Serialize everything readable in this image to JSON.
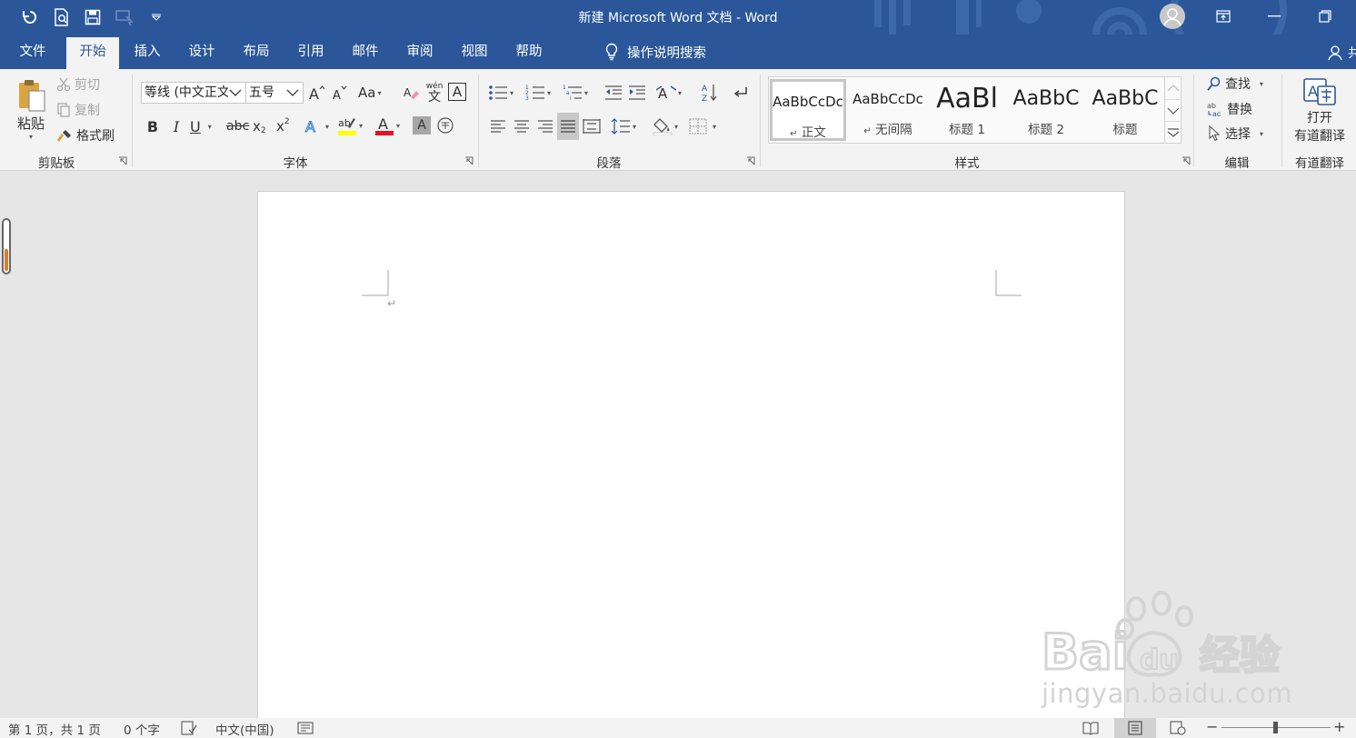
{
  "window": {
    "title": "新建 Microsoft Word 文档  -  Word",
    "accent": "#2b579a"
  },
  "quick_access": [
    "refresh-icon",
    "print-preview-icon",
    "save-icon",
    "touch-mode-icon",
    "customize-qat-icon"
  ],
  "tabs": [
    "文件",
    "开始",
    "插入",
    "设计",
    "布局",
    "引用",
    "邮件",
    "审阅",
    "视图",
    "帮助"
  ],
  "active_tab": "开始",
  "tell_me": "操作说明搜索",
  "share_partial": "共",
  "clipboard": {
    "paste": "粘贴",
    "cut": "剪切",
    "copy": "复制",
    "format_painter": "格式刷",
    "group": "剪贴板"
  },
  "font": {
    "name": "等线 (中文正文",
    "size": "五号",
    "change_case": "Aa",
    "phonetic_top": "wén",
    "phonetic_char": "文",
    "bold": "B",
    "italic": "I",
    "underline": "U",
    "strike": "abc",
    "subscript": "x",
    "sub_mark": "2",
    "superscript": "x",
    "sup_mark": "2",
    "char_a": "A",
    "group": "字体",
    "highlight_color": "#ffff00",
    "font_color": "#e81123"
  },
  "paragraph": {
    "group": "段落"
  },
  "styles": {
    "items": [
      {
        "preview": "AaBbCcDc",
        "name": "正文",
        "mark": "↵"
      },
      {
        "preview": "AaBbCcDc",
        "name": "无间隔",
        "mark": "↵"
      },
      {
        "preview": "AaBl",
        "name": "标题 1"
      },
      {
        "preview": "AaBbC",
        "name": "标题 2"
      },
      {
        "preview": "AaBbC",
        "name": "标题"
      }
    ],
    "group": "样式"
  },
  "editing": {
    "find": "查找",
    "replace": "替换",
    "select": "选择",
    "group": "编辑"
  },
  "youdao": {
    "line1": "打开",
    "line2": "有道翻译",
    "group": "有道翻译"
  },
  "document": {
    "paragraph_mark": "↵"
  },
  "status": {
    "page": "第 1 页，共 1 页",
    "words": "0 个字",
    "language": "中文(中国)"
  },
  "watermark": {
    "brand": "Bai",
    "brand2": "du",
    "cn": "经验",
    "host": "jingyan.baidu.com"
  }
}
